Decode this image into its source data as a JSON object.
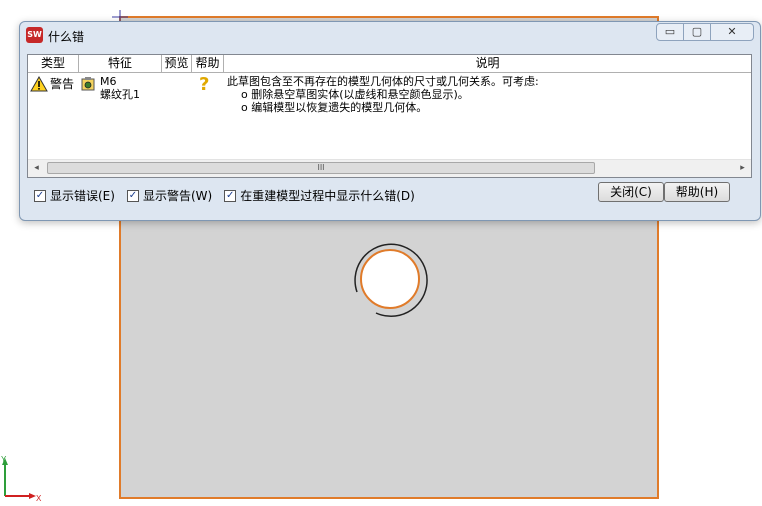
{
  "dialog": {
    "app_icon": "SW",
    "title": "什么错",
    "window_buttons": {
      "minimize": "▭",
      "maximize": "▢",
      "close": "✕"
    }
  },
  "list": {
    "headers": {
      "type": "类型",
      "feature": "特征",
      "preview": "预览",
      "help": "帮助",
      "description": "说明"
    },
    "rows": [
      {
        "type": "警告",
        "feature_line1": "M6",
        "feature_line2": "螺纹孔1",
        "help_glyph": "?",
        "desc_main": "此草图包含至不再存在的模型几何体的尺寸或几何关系。可考虑:",
        "desc_item1": "o 删除悬空草图实体(以虚线和悬空颜色显示)。",
        "desc_item2": "o 编辑模型以恢复遗失的模型几何体。"
      }
    ],
    "scrollbar": {
      "left_arrow": "◂",
      "right_arrow": "▸",
      "thumb_grip": "III"
    }
  },
  "options": {
    "show_errors": {
      "label": "显示错误(E)",
      "checked": true
    },
    "show_warnings": {
      "label": "显示警告(W)",
      "checked": true
    },
    "show_on_rebuild": {
      "label": "在重建模型过程中显示什么错(D)",
      "checked": true
    },
    "check_mark": "✓"
  },
  "buttons": {
    "close": "关闭(C)",
    "help": "帮助(H)"
  },
  "triad": {
    "y": "Y",
    "x": "X"
  },
  "colors": {
    "part_edge": "#e07b2a",
    "part_face": "#d3d3d3",
    "triad_y": "#2e9e3a",
    "triad_x": "#d02020"
  }
}
